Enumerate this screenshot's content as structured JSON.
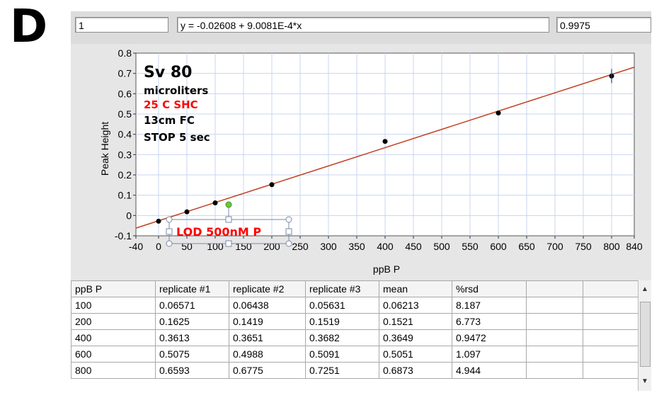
{
  "panel_label": "D",
  "header": {
    "index_value": "1",
    "equation": "y = -0.02608 + 9.0081E-4*x",
    "r_value": "0.9975"
  },
  "annotations": {
    "line1": "Sv 80",
    "line2": "microliters",
    "line3": "25 C  SHC",
    "line4": "13cm FC",
    "line5": "STOP 5 sec",
    "lod_label": "LOD 500nM P",
    "red_color": "#ff0000"
  },
  "chart_data": {
    "type": "scatter",
    "xlabel": "ppB P",
    "ylabel": "Peak Height",
    "xlim": [
      -40,
      840
    ],
    "ylim": [
      -0.1,
      0.8
    ],
    "x_ticks": [
      -40,
      0,
      50,
      100,
      150,
      200,
      250,
      300,
      350,
      400,
      450,
      500,
      550,
      600,
      650,
      700,
      750,
      800,
      840
    ],
    "y_ticks": [
      -0.1,
      0,
      0.1,
      0.2,
      0.3,
      0.4,
      0.5,
      0.6,
      0.7,
      0.8
    ],
    "y_tick_labels": [
      "-0.1",
      "0",
      "0.1",
      "0.2",
      "0.3",
      "0.4",
      "0.5",
      "0.6",
      "0.7",
      "0.8"
    ],
    "grid": true,
    "points": {
      "x": [
        0,
        50,
        100,
        200,
        400,
        600,
        800
      ],
      "y": [
        -0.028,
        0.018,
        0.062,
        0.152,
        0.365,
        0.505,
        0.687
      ]
    },
    "fit": {
      "intercept": -0.02608,
      "slope": 0.00090081
    },
    "line_color": "#c04020",
    "grid_color": "#c8d4f0",
    "plot_bg": "#ffffff",
    "point_color": "#000000"
  },
  "table": {
    "headers": [
      "ppB P",
      "replicate #1",
      "replicate #2",
      "replicate #3",
      "mean",
      "%rsd",
      "",
      ""
    ],
    "rows": [
      [
        "100",
        "0.06571",
        "0.06438",
        "0.05631",
        "0.06213",
        "8.187",
        "",
        ""
      ],
      [
        "200",
        "0.1625",
        "0.1419",
        "0.1519",
        "0.1521",
        "6.773",
        "",
        ""
      ],
      [
        "400",
        "0.3613",
        "0.3651",
        "0.3682",
        "0.3649",
        "0.9472",
        "",
        ""
      ],
      [
        "600",
        "0.5075",
        "0.4988",
        "0.5091",
        "0.5051",
        "1.097",
        "",
        ""
      ],
      [
        "800",
        "0.6593",
        "0.6775",
        "0.7251",
        "0.6873",
        "4.944",
        "",
        ""
      ]
    ]
  }
}
